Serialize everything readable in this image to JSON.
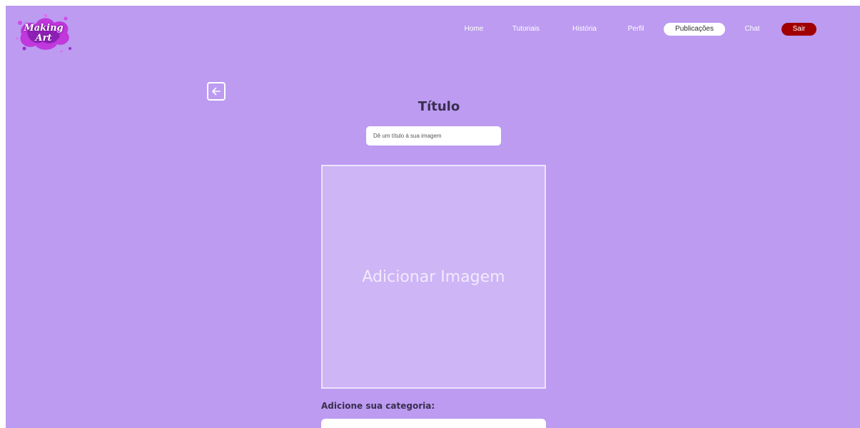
{
  "header": {
    "logo": {
      "line1": "Making",
      "line2": "Art"
    },
    "nav": [
      {
        "label": "Home"
      },
      {
        "label": "Tutoriais"
      },
      {
        "label": "História"
      },
      {
        "label": "Perfil"
      },
      {
        "label": "Publicações",
        "active": true
      },
      {
        "label": "Chat"
      },
      {
        "label": "Sair",
        "exit": true
      }
    ]
  },
  "form": {
    "back_icon": "arrow-left-icon",
    "title_heading": "Título",
    "title_placeholder": "Dê um título à sua imagem",
    "title_value": "",
    "image_upload_label": "Adicionar Imagem",
    "category_label": "Adicione sua categoria:",
    "category_value": ""
  },
  "colors": {
    "background": "#bc9bf1",
    "upload_area": "#ceb5f6",
    "active_nav": "#ffffff",
    "exit_button": "#a10000"
  }
}
